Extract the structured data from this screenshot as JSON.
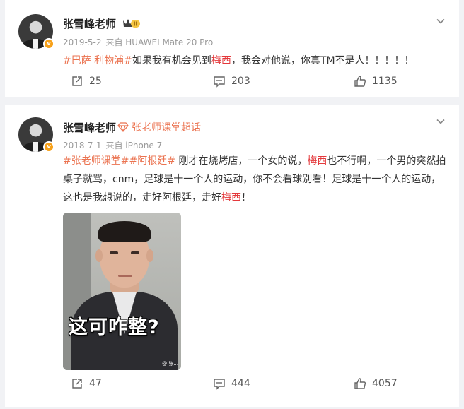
{
  "posts": [
    {
      "author": "张雪峰老师",
      "badge_level": "II",
      "date": "2019-5-2",
      "source": "来自 HUAWEI Mate 20 Pro",
      "tags": "#巴萨 利物浦#",
      "text_a": "如果我有机会见到",
      "highlight1": "梅西",
      "text_b": "，我会对他说，你真TM不是人！！！！！",
      "repost_count": "25",
      "comment_count": "203",
      "like_count": "1135"
    },
    {
      "author": "张雪峰老师",
      "super_topic": "张老师课堂超话",
      "date": "2018-7-1",
      "source": "来自 iPhone 7",
      "tags": "#张老师课堂##阿根廷#",
      "text_a": " 刚才在烧烤店，一个女的说，",
      "highlight1": "梅西",
      "text_b": "也不行啊，一个男的突然拍桌子就骂，cnm，足球是十一个人的运动，你不会看球别看！足球是十一个人的运动，这也是我想说的，走好阿根廷，走好",
      "highlight2": "梅西",
      "text_c": "！",
      "image_caption": "这可咋整?",
      "image_watermark": "@ 张...",
      "repost_count": "47",
      "comment_count": "444",
      "like_count": "4057"
    }
  ],
  "icons": {
    "verified": "verified-badge-icon",
    "more": "chevron-down-icon",
    "repost": "repost-icon",
    "comment": "comment-icon",
    "like": "like-icon"
  },
  "colors": {
    "tag": "#eb7350",
    "highlight": "#e4393c",
    "badge": "#f7a11a"
  }
}
